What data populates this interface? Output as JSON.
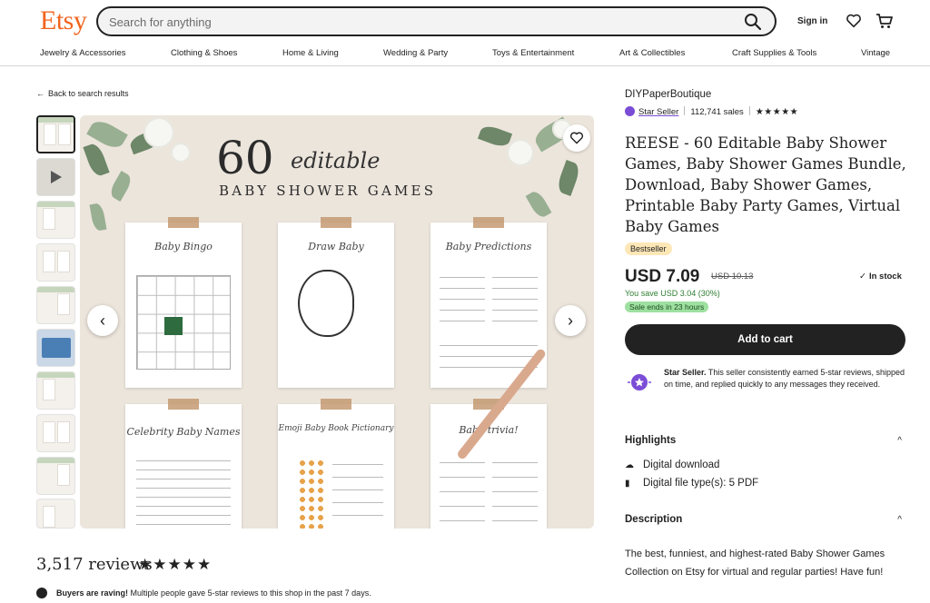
{
  "header": {
    "logo": "Etsy",
    "search_placeholder": "Search for anything",
    "signin": "Sign in",
    "search_icon": "search-icon",
    "heart_icon": "heart-icon",
    "cart_icon": "cart-icon"
  },
  "categories": [
    "Jewelry & Accessories",
    "Clothing & Shoes",
    "Home & Living",
    "Wedding & Party",
    "Toys & Entertainment",
    "Art & Collectibles",
    "Craft Supplies & Tools",
    "Vintage"
  ],
  "back_link": "Back to search results",
  "image": {
    "number": "60",
    "script_word": "editable",
    "subtitle": "BABY SHOWER GAMES",
    "cards": [
      "Baby Bingo",
      "Draw Baby",
      "Baby Predictions",
      "Celebrity Baby Names",
      "Emoji Baby Book Pictionary",
      "Baby trivia!"
    ]
  },
  "reviews": {
    "count_label": "3,517 reviews",
    "stars": "★★★★★",
    "raving_bold": "Buyers are raving!",
    "raving_text": " Multiple people gave 5-star reviews to this shop in the past 7 days."
  },
  "listing": {
    "shop_name": "DIYPaperBoutique",
    "star_seller_label": "Star Seller",
    "sales": "112,741 sales",
    "stars": "★★★★★",
    "title": "REESE - 60 Editable Baby Shower Games, Baby Shower Games Bundle, Download, Baby Shower Games, Printable Baby Party Games, Virtual Baby Games",
    "badge": "Bestseller",
    "price": "USD 7.09",
    "old_price": "USD 10.13",
    "stock": "In stock",
    "savings": "You save USD 3.04 (30%)",
    "sale_ends": "Sale ends in 23 hours",
    "add_to_cart": "Add to cart",
    "star_seller_bold": "Star Seller.",
    "star_seller_text": " This seller consistently earned 5-star reviews, shipped on time, and replied quickly to any messages they received."
  },
  "highlights": {
    "heading": "Highlights",
    "items": [
      "Digital download",
      "Digital file type(s): 5 PDF"
    ]
  },
  "description": {
    "heading": "Description",
    "text": "The best, funniest, and highest-rated Baby Shower Games Collection on Etsy for virtual and regular parties! Have fun!"
  },
  "colors": {
    "brand": "#f1641e",
    "star_seller": "#7b4dd6",
    "savings": "#2e7d32",
    "sale_badge": "#9ee0a0",
    "bestseller_badge": "#fde7b6"
  }
}
